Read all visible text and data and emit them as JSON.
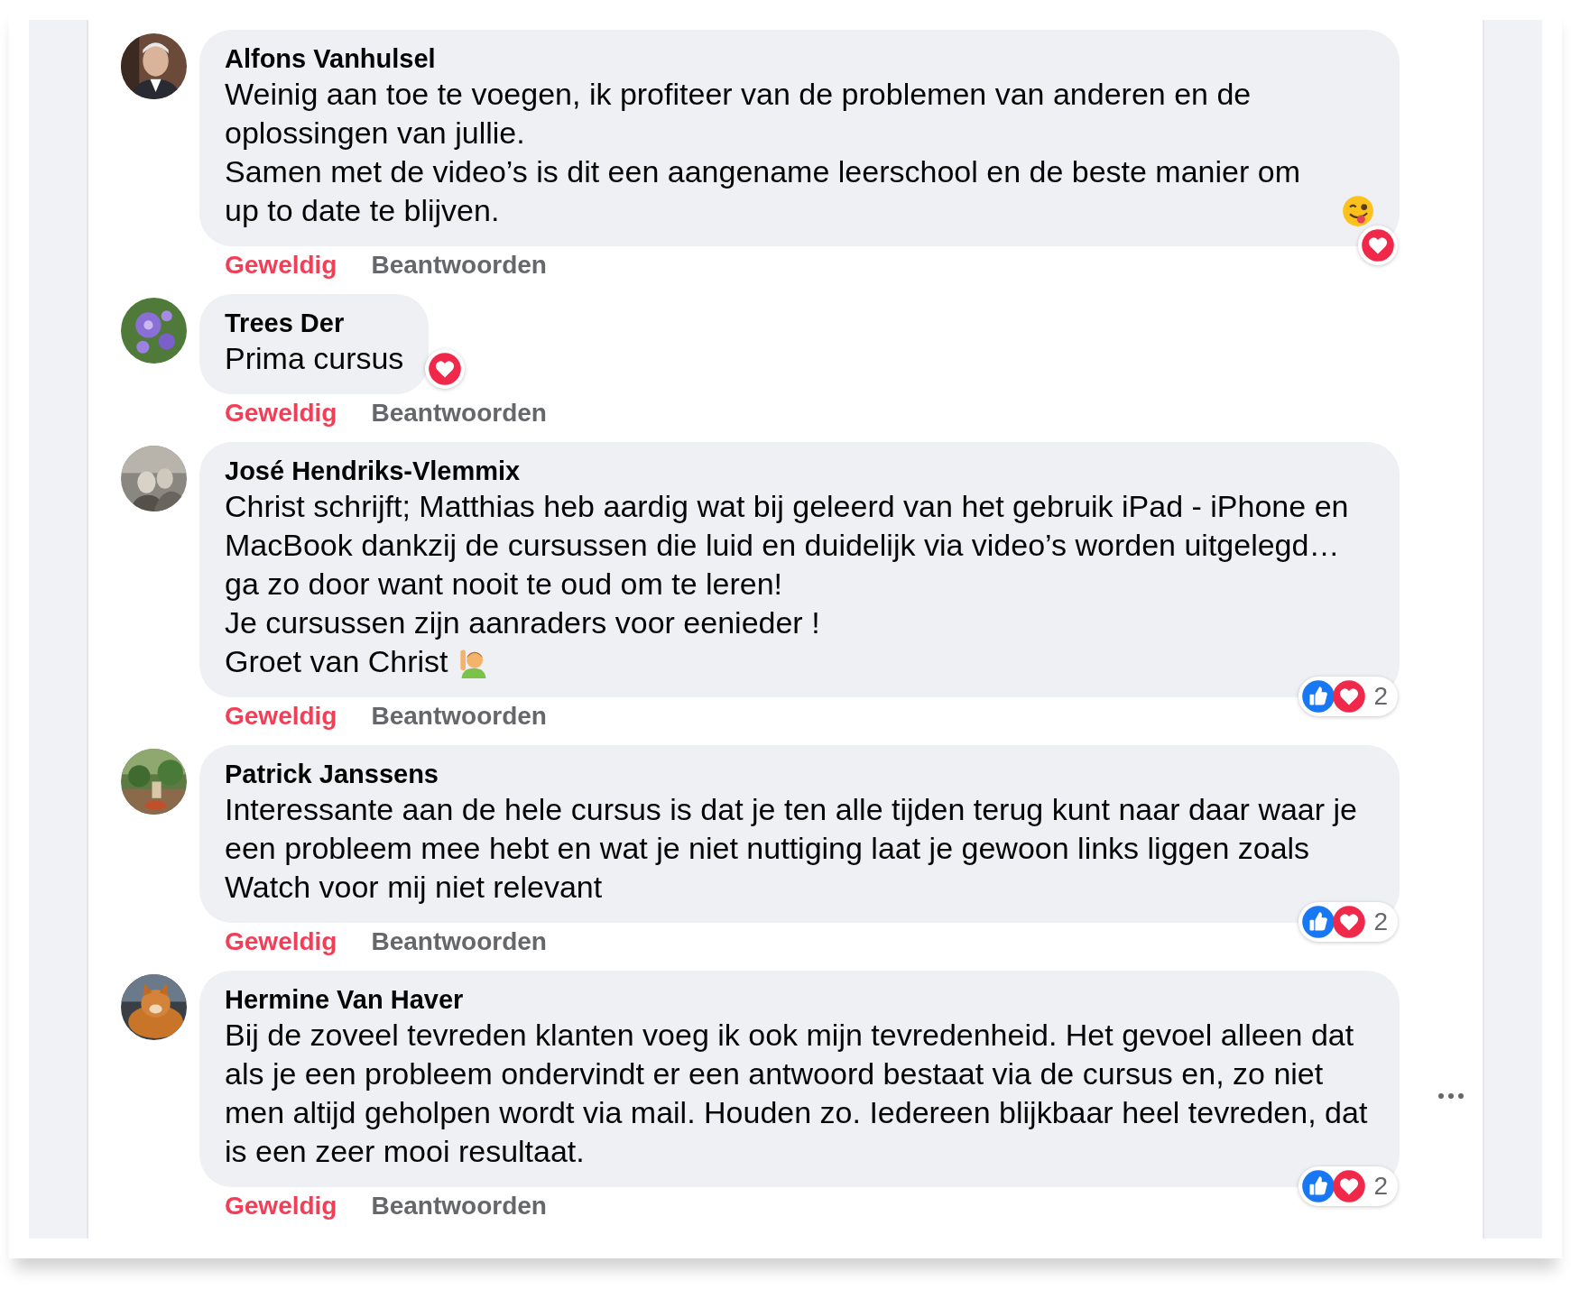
{
  "comments": [
    {
      "author": "Alfons Vanhulsel",
      "paragraphs": [
        "Weinig aan toe te voegen, ik profiteer van de problemen van anderen en de oplossingen van jullie.",
        "Samen met de video’s is dit een aangename leerschool en de beste manier om up to date te blijven."
      ],
      "emoji": {
        "kind": "wink-tongue"
      },
      "reactions": [
        {
          "kind": "love"
        }
      ],
      "reacted": true,
      "menu": false,
      "actions": [
        "Geweldig",
        "Beantwoorden"
      ]
    },
    {
      "author": "Trees Der",
      "paragraphs": [
        "Prima cursus"
      ],
      "reactions": [
        {
          "kind": "love"
        }
      ],
      "reacted": true,
      "menu": false,
      "actions": [
        "Geweldig",
        "Beantwoorden"
      ]
    },
    {
      "author": "José Hendriks-Vlemmix",
      "paragraphs": [
        "Christ schrijft; Matthias heb aardig wat bij geleerd van het gebruik iPad - iPhone en MacBook dankzij de cursussen die luid en duidelijk via video’s worden uitgelegd… ga zo door want nooit te oud om te leren!",
        "Je cursussen zijn aanraders voor eenieder !",
        "Groet van Christ"
      ],
      "emoji": {
        "kind": "raising-hand"
      },
      "reactions": [
        {
          "kind": "like"
        },
        {
          "kind": "love"
        }
      ],
      "count": "2",
      "reacted": true,
      "menu": false,
      "actions": [
        "Geweldig",
        "Beantwoorden"
      ]
    },
    {
      "author": "Patrick Janssens",
      "paragraphs": [
        "Interessante aan de hele cursus is dat je ten alle tijden terug kunt naar daar waar je een probleem mee hebt en wat je niet nuttiging laat je gewoon links liggen zoals Watch voor mij niet relevant"
      ],
      "reactions": [
        {
          "kind": "like"
        },
        {
          "kind": "love"
        }
      ],
      "count": "2",
      "reacted": true,
      "menu": false,
      "actions": [
        "Geweldig",
        "Beantwoorden"
      ]
    },
    {
      "author": "Hermine Van Haver",
      "paragraphs": [
        "Bij de zoveel tevreden klanten voeg ik ook mijn tevredenheid. Het gevoel alleen dat als je een probleem ondervindt er een antwoord bestaat via de cursus en, zo niet men altijd geholpen wordt via mail. Houden zo. Iedereen blijkbaar heel tevreden, dat is een zeer mooi resultaat."
      ],
      "reactions": [
        {
          "kind": "like"
        },
        {
          "kind": "love"
        }
      ],
      "count": "2",
      "reacted": true,
      "menu": true,
      "actions": [
        "Geweldig",
        "Beantwoorden"
      ]
    }
  ]
}
